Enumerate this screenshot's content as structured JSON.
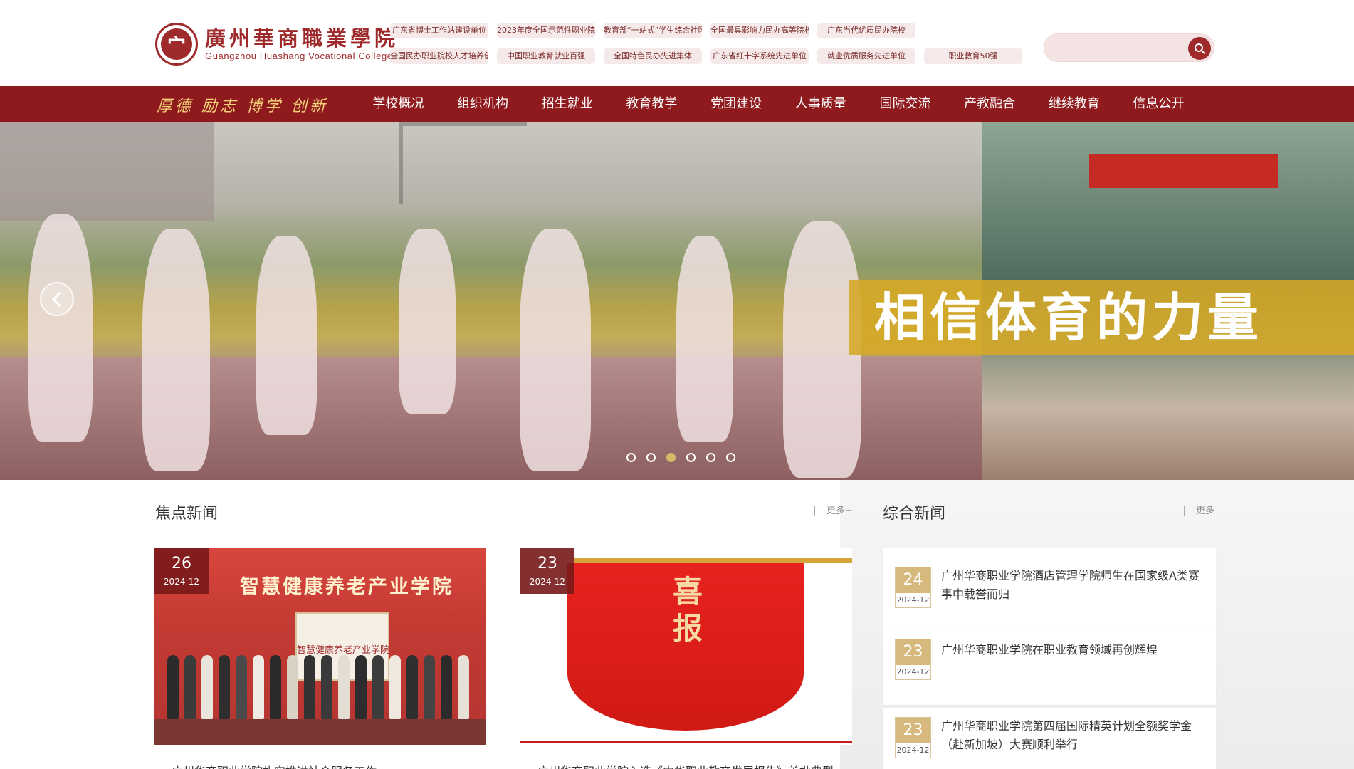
{
  "header": {
    "logo_cn": "廣州華商職業學院",
    "logo_en": "Guangzhou Huashang Vocational College",
    "logo_seal": "宀",
    "badges": [
      "广东省博士工作站建设单位",
      "2023年度全国示范性职业院校",
      "教育部“一站式”学生综合社区试点单位",
      "全国最具影响力民办高等院校",
      "广东当代优质民办院校",
      "全国民办职业院校人才培养创新奖",
      "中国职业教育就业百强",
      "全国特色民办先进集体",
      "广东省红十字系统先进单位",
      "就业优质服务先进单位",
      "职业教育50强"
    ],
    "search": {
      "placeholder": "",
      "icon": "search-icon"
    }
  },
  "nav": {
    "motto": "厚德 励志 博学 创新",
    "items": [
      "学校概况",
      "组织机构",
      "招生就业",
      "教育教学",
      "党团建设",
      "人事质量",
      "国际交流",
      "产教融合",
      "继续教育",
      "信息公开"
    ]
  },
  "banner": {
    "slogan": "相信体育的力量",
    "dots_count": 6,
    "active_dot": 3
  },
  "focus_news": {
    "title": "焦点新闻",
    "more": "更多+",
    "cards": [
      {
        "day": "26",
        "ym": "2024-12",
        "image_text": "智慧健康养老产业学院",
        "plaque_text": "智慧健康养老产业学院",
        "caption": "广州华商职业学院扎实推进社会服务工作"
      },
      {
        "day": "23",
        "ym": "2024-12",
        "image_text": "喜报",
        "caption": "广州华商职业学院入选《中华职业教育发展报告》首批典型"
      }
    ]
  },
  "general_news": {
    "title": "综合新闻",
    "more": "更多",
    "items": [
      {
        "day": "24",
        "ym": "2024-12",
        "title": "广州华商职业学院酒店管理学院师生在国家级A类赛事中载誉而归"
      },
      {
        "day": "23",
        "ym": "2024-12",
        "title": "广州华商职业学院在职业教育领域再创辉煌"
      },
      {
        "day": "23",
        "ym": "2024-12",
        "title": "广州华商职业学院第四届国际精英计划全额奖学金（赴新加坡）大赛顺利举行"
      }
    ]
  },
  "colors": {
    "primary": "#8e1a1d",
    "gold": "#d8b97d",
    "motto": "#f5d27a"
  }
}
